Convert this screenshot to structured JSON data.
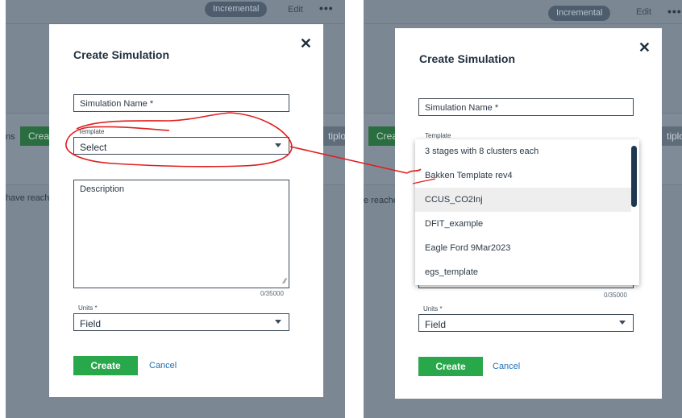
{
  "background": {
    "pill_label": "Incremental",
    "edit_label": "Edit",
    "more_glyph": "•••",
    "create_partial_left": "Crea",
    "create_partial_right": "Crea",
    "tab_partial": "ns",
    "plot_partial_left": "tiplot",
    "plot_partial_right": "tiplot",
    "reached_partial_left": "have reached",
    "reached_partial_right": "e reached"
  },
  "modal": {
    "title": "Create Simulation",
    "close_glyph": "✕",
    "simulation_name_placeholder": "Simulation Name *",
    "template_label": "Template",
    "template_value": "Select",
    "description_placeholder": "Description",
    "char_counter": "0/35000",
    "units_label": "Units *",
    "units_value": "Field",
    "create_label": "Create",
    "cancel_label": "Cancel"
  },
  "dropdown": {
    "items": [
      "3 stages with 8 clusters each",
      "Bakken Template rev4",
      "CCUS_CO2Inj",
      "DFIT_example",
      "Eagle Ford 9Mar2023",
      "egs_template"
    ],
    "hovered_index": 2
  },
  "colors": {
    "annotation": "#e01f1f",
    "primary_button": "#28a74b",
    "link": "#1f6fb5",
    "overlay": "#7b8893"
  }
}
